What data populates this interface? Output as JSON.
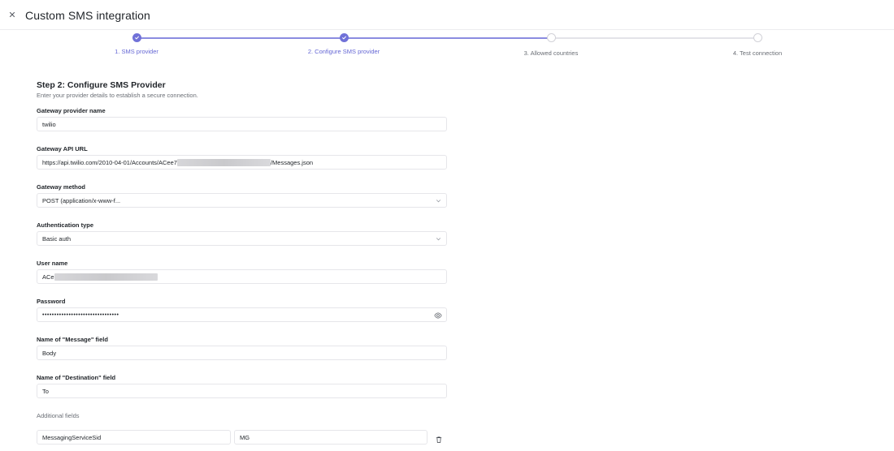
{
  "header": {
    "title": "Custom SMS integration"
  },
  "stepper": {
    "steps": [
      {
        "label": "1. SMS provider",
        "status": "done"
      },
      {
        "label": "2. Configure SMS provider",
        "status": "done"
      },
      {
        "label": "3. Allowed countries",
        "status": "todo"
      },
      {
        "label": "4. Test connection",
        "status": "todo"
      }
    ]
  },
  "step": {
    "title": "Step 2: Configure SMS Provider",
    "subtitle": "Enter your provider details to establish a secure connection."
  },
  "form": {
    "gateway_name": {
      "label": "Gateway provider name",
      "value": "twilio"
    },
    "gateway_url": {
      "label": "Gateway API URL",
      "value_prefix": "https://api.twilio.com/2010-04-01/Accounts/ACee7",
      "value_suffix": "/Messages.json"
    },
    "gateway_method": {
      "label": "Gateway method",
      "value": "POST (application/x-www-f..."
    },
    "auth_type": {
      "label": "Authentication type",
      "value": "Basic auth"
    },
    "user_name": {
      "label": "User name",
      "value_prefix": "ACe"
    },
    "password": {
      "label": "Password",
      "value": "••••••••••••••••••••••••••••••••"
    },
    "message_field": {
      "label": "Name of \"Message\" field",
      "value": "Body"
    },
    "destination_field": {
      "label": "Name of \"Destination\" field",
      "value": "To"
    }
  },
  "additional": {
    "label": "Additional fields",
    "rows": [
      {
        "key": "MessagingServiceSid",
        "value_prefix": "MG"
      }
    ]
  },
  "colors": {
    "accent": "#7071d8",
    "accent_text": "#6466d4",
    "muted_text": "#6b6f76",
    "border": "#e6e6ea"
  },
  "icons": {
    "close": "close-icon",
    "check": "check-icon",
    "chevron": "chevron-down-icon",
    "eye": "eye-icon",
    "trash": "trash-icon"
  }
}
